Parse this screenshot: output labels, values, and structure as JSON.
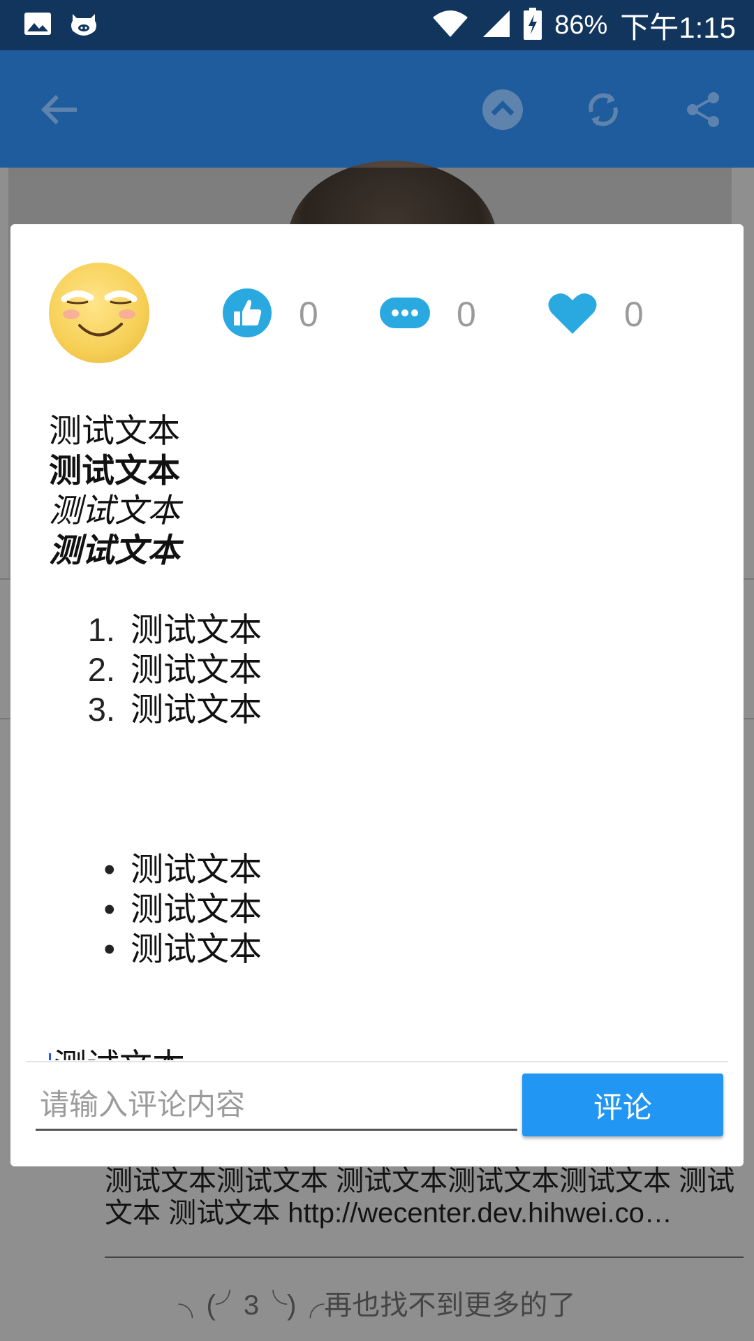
{
  "status_bar": {
    "battery": "86%",
    "time": "下午1:15",
    "icons": [
      "image-icon",
      "pig-app-icon",
      "wifi-icon",
      "signal-icon",
      "battery-charging-icon"
    ]
  },
  "app_bar": {
    "icons": [
      "back-arrow-icon",
      "chevron-up-circle-icon",
      "refresh-icon",
      "share-icon"
    ]
  },
  "dialog": {
    "avatar": "smiley-face-avatar",
    "stats": {
      "likes": "0",
      "comments": "0",
      "favorites": "0"
    },
    "content": {
      "plain": "测试文本",
      "bold": "测试文本",
      "italic": "测试文本",
      "bold_italic": "测试文本",
      "ordered_list": [
        "测试文本",
        "测试文本",
        "测试文本"
      ],
      "ordered_markers": [
        "1.",
        "2.",
        "3."
      ],
      "bullet_list": [
        "测试文本",
        "测试文本",
        "测试文本"
      ],
      "bullet_marker": "•",
      "trailing": "测试文本"
    },
    "comment_input": {
      "placeholder": "请输入评论内容",
      "value": ""
    },
    "submit_label": "评论"
  },
  "background": {
    "comment_text": "测试文本测试文本 测试文本测试文本测试文本 测试文本 测试文本 http://wecenter.dev.hihwei.co…",
    "end_text": "╮(╯3╰)╭再也找不到更多的了"
  },
  "colors": {
    "status_bar": "#12355e",
    "app_bar": "#1f5c9d",
    "accent": "#2196f3",
    "stat_icon": "#29a9e0"
  }
}
